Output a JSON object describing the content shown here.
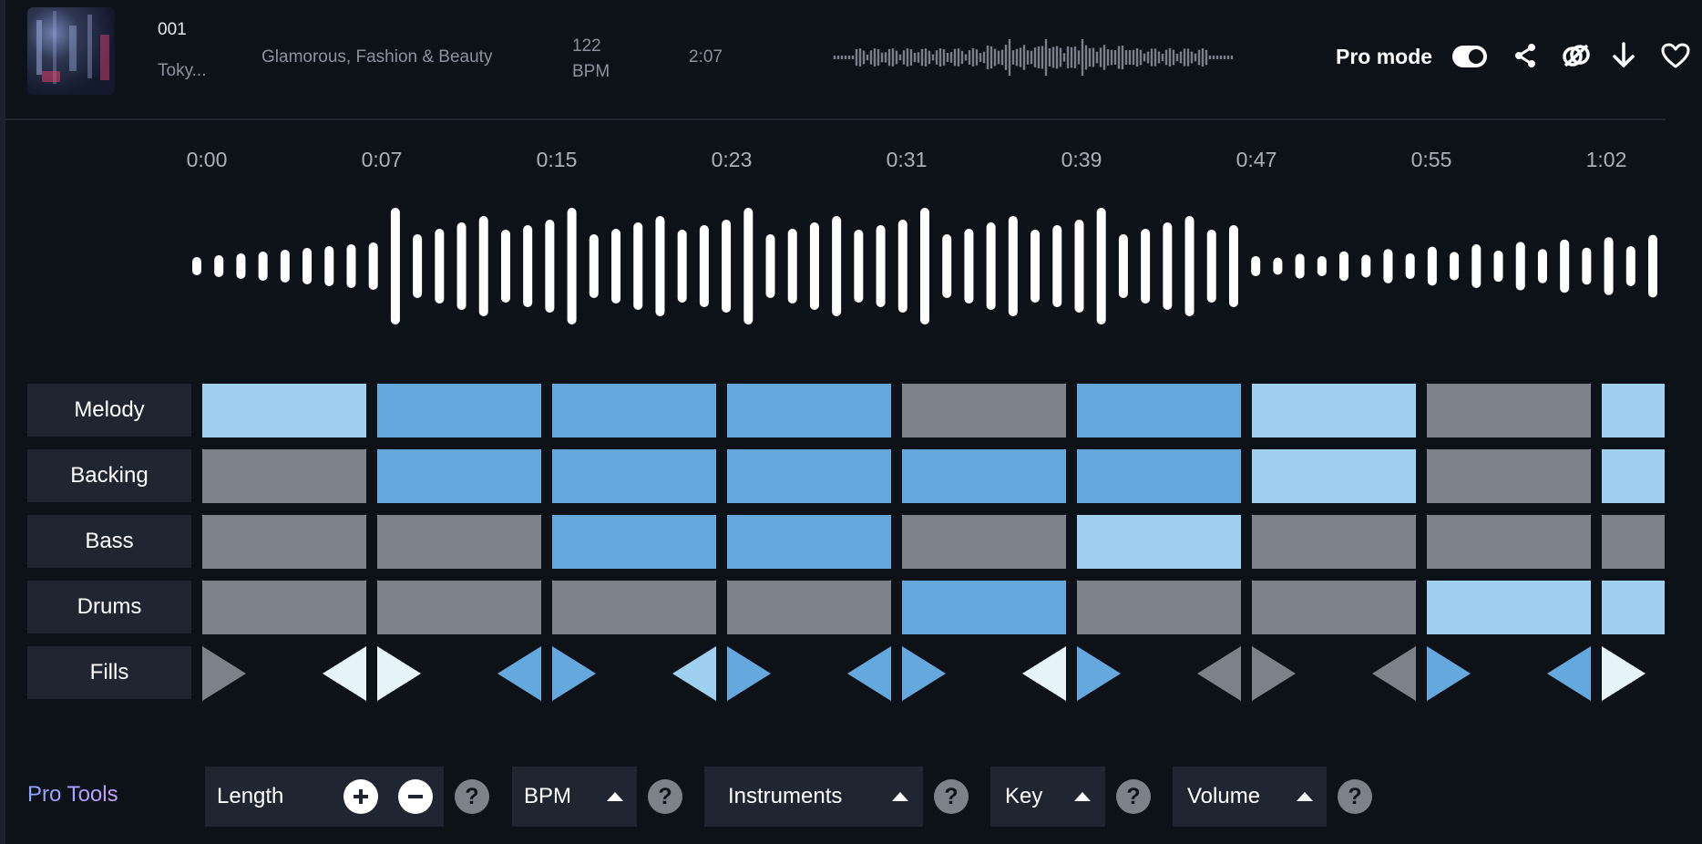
{
  "track": {
    "number": "001",
    "name": "Toky...",
    "tags": "Glamorous, Fashion & Beauty",
    "bpm_value": "122",
    "bpm_unit": "BPM",
    "duration": "2:07"
  },
  "header_actions": {
    "pro_mode_label": "Pro mode",
    "pro_mode_on": true,
    "icons": [
      "share-icon",
      "link-icon",
      "download-icon",
      "favorite-icon"
    ]
  },
  "timeline": {
    "ticks": [
      "0:00",
      "0:07",
      "0:15",
      "0:23",
      "0:31",
      "0:39",
      "0:47",
      "0:55",
      "1:02"
    ]
  },
  "colors": {
    "active": "#64a8de",
    "light": "#a0d0f0",
    "inactive": "#7d828a",
    "white": "#e6f3fb"
  },
  "arranger": {
    "rows": [
      {
        "label": "Melody",
        "cells": [
          "light",
          "active",
          "active",
          "active",
          "inactive",
          "active",
          "light",
          "inactive",
          "light"
        ]
      },
      {
        "label": "Backing",
        "cells": [
          "inactive",
          "active",
          "active",
          "active",
          "active",
          "active",
          "light",
          "inactive",
          "light"
        ]
      },
      {
        "label": "Bass",
        "cells": [
          "inactive",
          "inactive",
          "active",
          "active",
          "inactive",
          "light",
          "inactive",
          "inactive",
          "inactive"
        ]
      },
      {
        "label": "Drums",
        "cells": [
          "inactive",
          "inactive",
          "inactive",
          "inactive",
          "active",
          "inactive",
          "inactive",
          "light",
          "light"
        ]
      }
    ],
    "fills_label": "Fills",
    "fills": [
      [
        "inactive"
      ],
      [
        "white",
        "white"
      ],
      [
        "active",
        "active"
      ],
      [
        "light",
        "active"
      ],
      [
        "active",
        "active"
      ],
      [
        "white",
        "active"
      ],
      [
        "inactive",
        "inactive"
      ],
      [
        "inactive",
        "active"
      ],
      [
        "active",
        "white"
      ]
    ]
  },
  "pro_tools": {
    "label": "Pro Tools",
    "length_label": "Length",
    "bpm_label": "BPM",
    "instruments_label": "Instruments",
    "key_label": "Key",
    "volume_label": "Volume",
    "help_glyph": "?"
  }
}
